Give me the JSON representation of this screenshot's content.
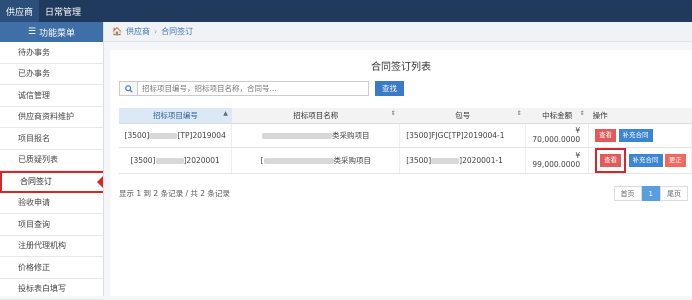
{
  "topbar": {
    "tabs": [
      "供应商",
      "日常管理"
    ]
  },
  "sidebar": {
    "title": "功能菜单",
    "items": [
      "待办事务",
      "已办事务",
      "诚信管理",
      "供应商资料维护",
      "项目报名",
      "已质疑列表",
      "合同签订",
      "验收申请",
      "项目查询",
      "注册代理机构",
      "价格修正",
      "投标表白填写"
    ]
  },
  "breadcrumb": {
    "home": "供应商",
    "current": "合同签订"
  },
  "main": {
    "title": "合同签订列表",
    "search": {
      "placeholder": "招标项目编号，招标项目名称，合同号...",
      "button": "查找"
    },
    "table": {
      "headers": [
        "招标项目编号",
        "招标项目名称",
        "包号",
        "中标金额",
        "操作"
      ],
      "rows": [
        {
          "code_pre": "[3500]",
          "code_post": "[TP]2019004",
          "name_post": "类采购项目",
          "pkg": "[3500]FJGC[TP]2019004-1",
          "amount": "¥ 70,000.0000",
          "actions": [
            "查看",
            "补充合同"
          ]
        },
        {
          "code_pre": "[3500]",
          "code_post": "]2020001",
          "name_pre": "[",
          "name_post": "类采购项目",
          "pkg": "[3500]",
          "pkg_post": "]2020001-1",
          "amount": "¥ 99,000.0000",
          "actions": [
            "查看",
            "补充合同",
            "更正"
          ]
        }
      ]
    },
    "footer": "显示 1 到 2 条记录 / 共 2 条记录",
    "pager": [
      "首页",
      "1",
      "尾页"
    ]
  },
  "colors": {
    "topbar": "#1f3a5c",
    "accent": "#3a7bc8",
    "highlight": "#d6252b"
  }
}
